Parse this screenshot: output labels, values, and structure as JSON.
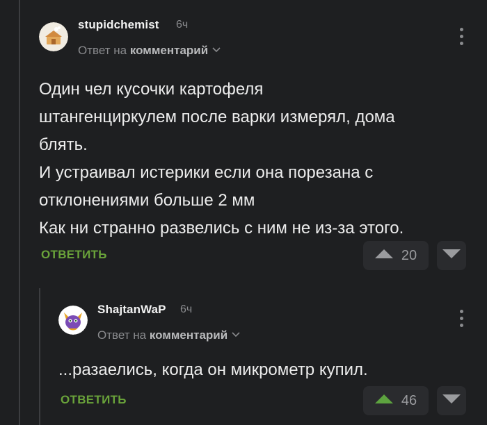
{
  "comments": [
    {
      "username": "stupidchemist",
      "time": "6ч",
      "reply_prefix": "Ответ на",
      "reply_target": "комментарий",
      "body": [
        "Один чел кусочки картофеля",
        "штангенциркулем после варки измерял, дома",
        "блять.",
        "И устраивал истерики если она порезана с",
        "отклонениями больше 2 мм",
        "Как ни странно развелись с ним не из-за этого."
      ],
      "reply_label": "ОТВЕТИТЬ",
      "score": "20",
      "upvote_color": "#9a9b9e",
      "avatar": "cat-house-avatar"
    },
    {
      "username": "ShajtanWaP",
      "time": "6ч",
      "reply_prefix": "Ответ на",
      "reply_target": "комментарий",
      "body": [
        "...разаелись, когда он микрометр купил."
      ],
      "reply_label": "ОТВЕТИТЬ",
      "score": "46",
      "upvote_color": "#5da33f",
      "avatar": "purple-dragon-avatar"
    }
  ],
  "colors": {
    "background": "#1e1f21",
    "accent_green": "#6aa33a",
    "muted": "#8a8b8e"
  }
}
